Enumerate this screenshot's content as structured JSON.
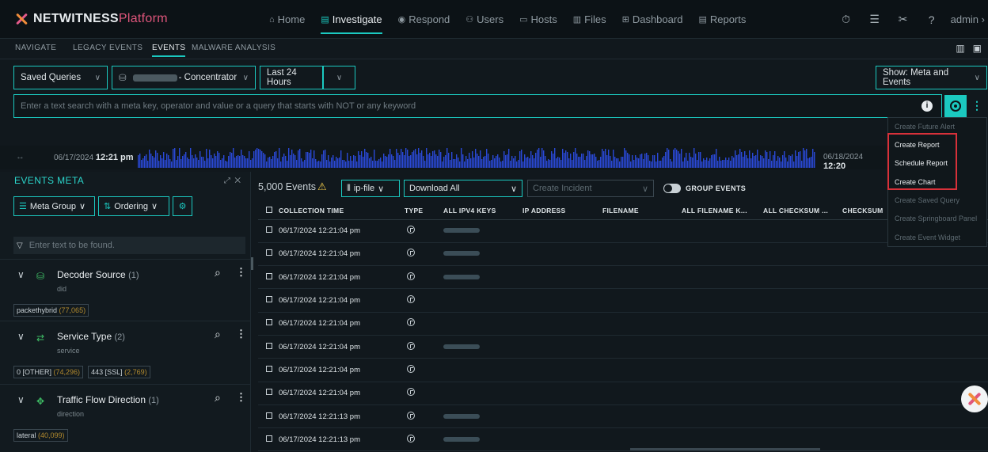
{
  "app": {
    "logo_main": "NETWITNESS",
    "logo_sub": "Platform"
  },
  "nav": {
    "home": "Home",
    "investigate": "Investigate",
    "respond": "Respond",
    "users": "Users",
    "hosts": "Hosts",
    "files": "Files",
    "dashboard": "Dashboard",
    "reports": "Reports",
    "admin": "admin"
  },
  "subnav": {
    "navigate": "NAVIGATE",
    "legacy_events": "LEGACY EVENTS",
    "events": "EVENTS",
    "malware_analysis": "MALWARE ANALYSIS"
  },
  "query": {
    "saved_queries": "Saved Queries",
    "service_suffix": "- Concentrator",
    "time_range": "Last 24 Hours",
    "show": "Show: Meta and Events",
    "search_placeholder": "Enter a text search with a meta key, operator and value or a query that starts with NOT or any keyword"
  },
  "timeline": {
    "start_date": "06/17/2024",
    "start_time": "12:21 pm",
    "end_date": "06/18/2024",
    "end_time": "12:20"
  },
  "meta_panel": {
    "title": "EVENTS META",
    "meta_group_btn": "Meta Group",
    "ordering_btn": "Ordering",
    "filter_placeholder": "Enter text to be found.",
    "groups": [
      {
        "name": "Decoder Source",
        "count": "(1)",
        "key": "did",
        "values": [
          {
            "label": "packethybrid",
            "count": "(77,065)"
          }
        ]
      },
      {
        "name": "Service Type",
        "count": "(2)",
        "key": "service",
        "values": [
          {
            "label": "0 [OTHER]",
            "count": "(74,296)"
          },
          {
            "label": "443 [SSL]",
            "count": "(2,769)"
          }
        ]
      },
      {
        "name": "Traffic Flow Direction",
        "count": "(1)",
        "key": "direction",
        "values": [
          {
            "label": "lateral",
            "count": "(40,099)"
          }
        ]
      }
    ]
  },
  "events": {
    "count_label": "5,000 Events",
    "profile_btn": "ip-file",
    "download_btn": "Download All",
    "create_incident": "Create Incident",
    "group_events": "GROUP EVENTS",
    "columns": [
      "COLLECTION TIME",
      "TYPE",
      "ALL IPV4 KEYS",
      "IP ADDRESS",
      "FILENAME",
      "ALL FILENAME K...",
      "ALL CHECKSUM ...",
      "CHECKSUM"
    ],
    "rows": [
      {
        "time": "06/17/2024 12:21:04 pm",
        "ip": true
      },
      {
        "time": "06/17/2024 12:21:04 pm",
        "ip": true
      },
      {
        "time": "06/17/2024 12:21:04 pm",
        "ip": true
      },
      {
        "time": "06/17/2024 12:21:04 pm",
        "ip": false
      },
      {
        "time": "06/17/2024 12:21:04 pm",
        "ip": false
      },
      {
        "time": "06/17/2024 12:21:04 pm",
        "ip": true
      },
      {
        "time": "06/17/2024 12:21:04 pm",
        "ip": false
      },
      {
        "time": "06/17/2024 12:21:04 pm",
        "ip": false
      },
      {
        "time": "06/17/2024 12:21:13 pm",
        "ip": true
      },
      {
        "time": "06/17/2024 12:21:13 pm",
        "ip": true
      }
    ]
  },
  "menu": {
    "items": [
      {
        "label": "Create Future Alert",
        "enabled": false
      },
      {
        "label": "Create Report",
        "enabled": true
      },
      {
        "label": "Schedule Report",
        "enabled": true
      },
      {
        "label": "Create Chart",
        "enabled": true
      },
      {
        "label": "Create Saved Query",
        "enabled": false
      },
      {
        "label": "Create Springboard Panel",
        "enabled": false
      },
      {
        "label": "Create Event Widget",
        "enabled": false
      }
    ]
  },
  "colors": {
    "accent": "#1bc9c0",
    "background": "#11181d",
    "highlight_box": "#d8313a",
    "timeline_bars": "#2a49d6"
  }
}
